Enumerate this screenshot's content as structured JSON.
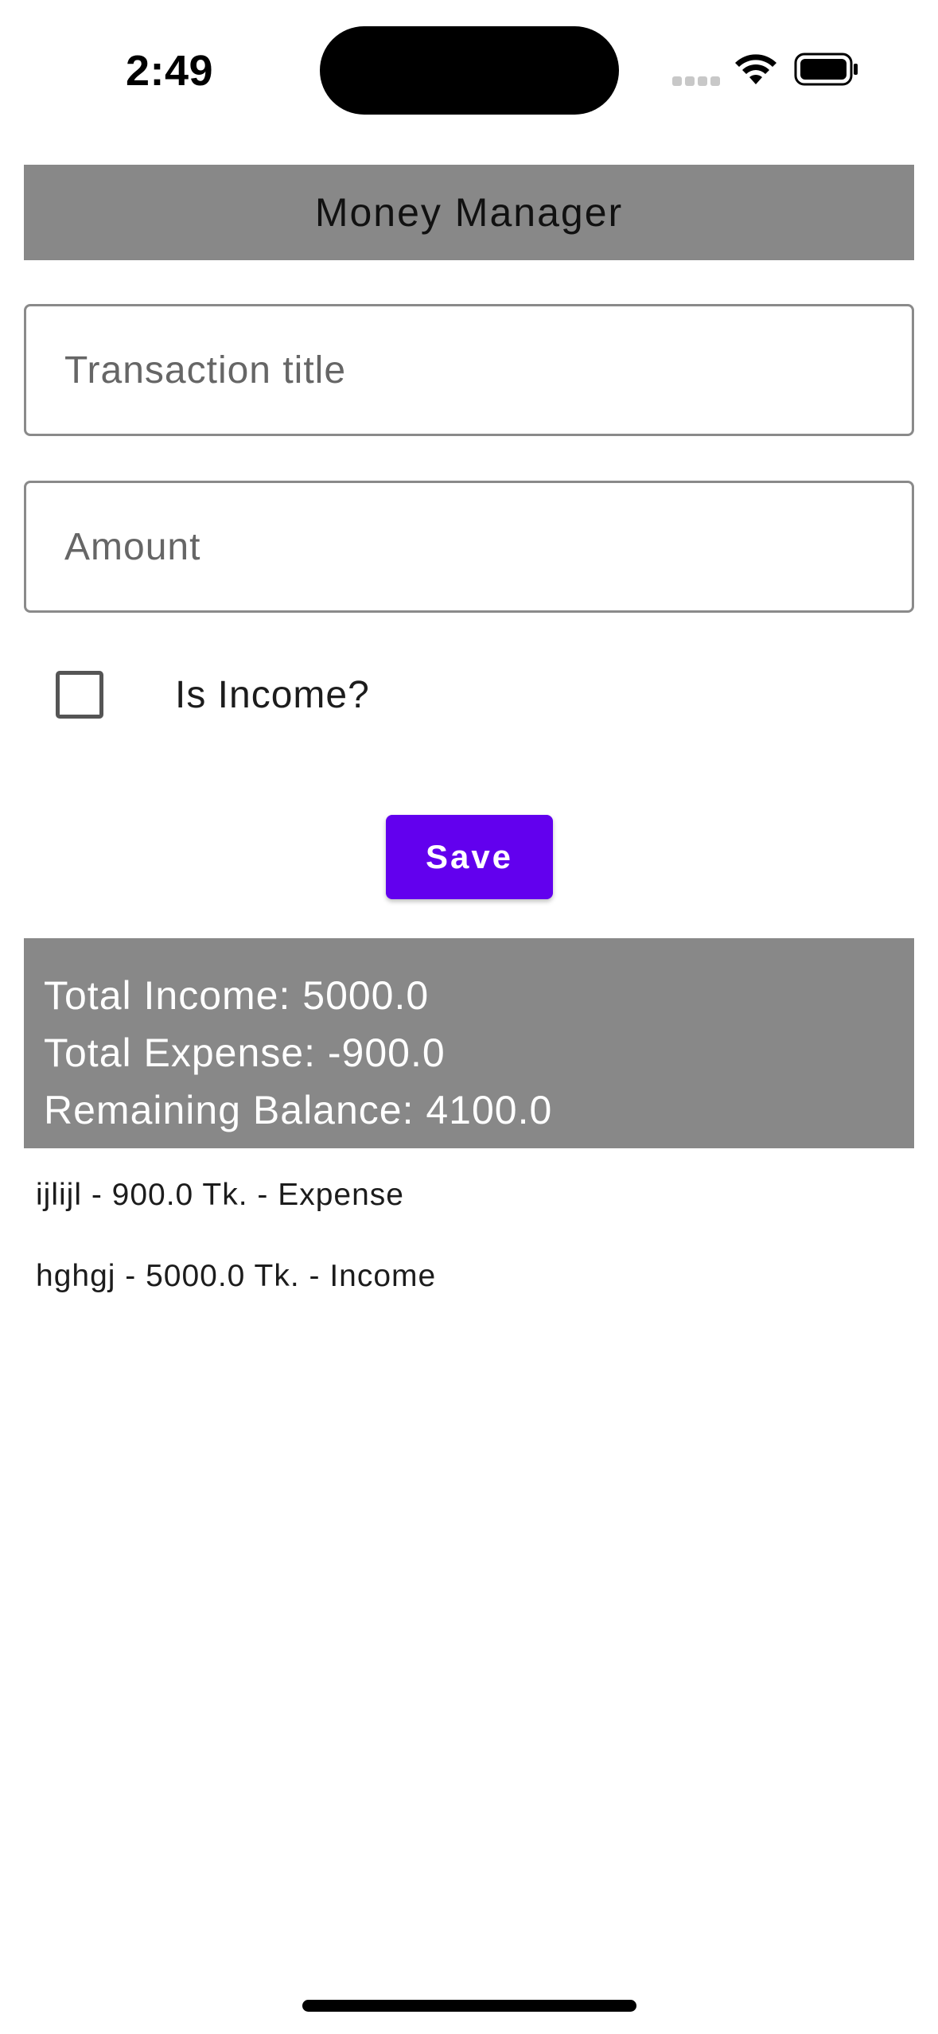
{
  "status_bar": {
    "time": "2:49",
    "icons": [
      "signal-icon",
      "wifi-icon",
      "battery-icon"
    ]
  },
  "app_bar": {
    "title": "Money Manager"
  },
  "form": {
    "title_field": {
      "placeholder": "Transaction title",
      "value": ""
    },
    "amount_field": {
      "placeholder": "Amount",
      "value": ""
    },
    "income_checkbox": {
      "label": "Is Income?",
      "checked": false
    },
    "save_label": "Save"
  },
  "summary": {
    "total_income": "Total Income: 5000.0",
    "total_expense": "Total Expense: -900.0",
    "remaining_balance": "Remaining Balance: 4100.0"
  },
  "transactions": [
    {
      "text": "ijlijl - 900.0 Tk. - Expense"
    },
    {
      "text": "hghgj - 5000.0 Tk. - Income"
    }
  ],
  "colors": {
    "accent": "#6200ee",
    "bar_gray": "#888888",
    "background": "#ffffff"
  }
}
